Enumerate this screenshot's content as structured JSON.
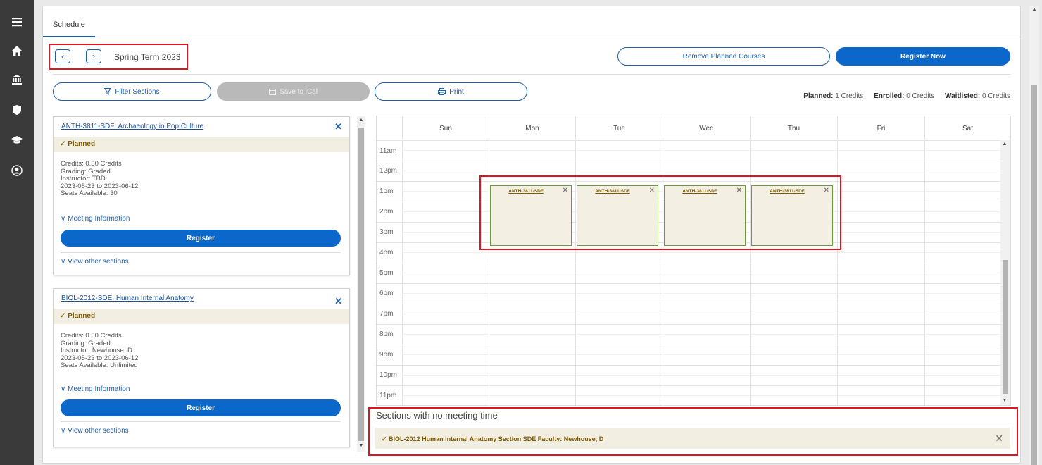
{
  "nav": {
    "icons": [
      "menu-icon",
      "home-icon",
      "bank-icon",
      "shield-icon",
      "graduation-cap-icon",
      "user-circle-icon"
    ]
  },
  "tab": {
    "label": "Schedule"
  },
  "term": {
    "prev": "‹",
    "next": "›",
    "label": "Spring Term 2023"
  },
  "actions": {
    "remove_planned": "Remove Planned Courses",
    "register_now": "Register Now",
    "filter_sections": "Filter Sections",
    "save_ical": "Save to iCal",
    "print": "Print"
  },
  "credits": {
    "planned_label": "Planned:",
    "planned_value": "1 Credits",
    "enrolled_label": "Enrolled:",
    "enrolled_value": "0 Credits",
    "waitlisted_label": "Waitlisted:",
    "waitlisted_value": "0 Credits"
  },
  "courses": [
    {
      "title": "ANTH-3811-SDF: Archaeology in Pop Culture",
      "status": "Planned",
      "credits": "Credits: 0.50 Credits",
      "grading": "Grading: Graded",
      "instructor": "Instructor: TBD",
      "dates": "2023-05-23 to 2023-06-12",
      "seats": "Seats Available:  30",
      "meeting_info": "Meeting Information",
      "register": "Register",
      "other_sections": "View other sections"
    },
    {
      "title": "BIOL-2012-SDE: Human Internal Anatomy",
      "status": "Planned",
      "credits": "Credits: 0.50 Credits",
      "grading": "Grading: Graded",
      "instructor": "Instructor: Newhouse, D",
      "dates": "2023-05-23 to 2023-06-12",
      "seats": "Seats Available:  Unlimited",
      "meeting_info": "Meeting Information",
      "register": "Register",
      "other_sections": "View other sections"
    }
  ],
  "calendar": {
    "days": [
      "Sun",
      "Mon",
      "Tue",
      "Wed",
      "Thu",
      "Fri",
      "Sat"
    ],
    "hours": [
      "11am",
      "12pm",
      "1pm",
      "2pm",
      "3pm",
      "4pm",
      "5pm",
      "6pm",
      "7pm",
      "8pm",
      "9pm",
      "10pm",
      "11pm"
    ],
    "events": [
      {
        "label": "ANTH-3811-SDF",
        "day": "Mon",
        "start": "1pm",
        "end": "4pm"
      },
      {
        "label": "ANTH-3811-SDF",
        "day": "Tue",
        "start": "1pm",
        "end": "4pm"
      },
      {
        "label": "ANTH-3811-SDF",
        "day": "Wed",
        "start": "1pm",
        "end": "4pm"
      },
      {
        "label": "ANTH-3811-SDF",
        "day": "Thu",
        "start": "1pm",
        "end": "4pm"
      }
    ]
  },
  "no_meeting": {
    "title": "Sections with no meeting time",
    "item": "BIOL-2012 Human Internal Anatomy Section SDE Faculty: Newhouse, D"
  },
  "colors": {
    "primary": "#0b67c9",
    "highlight": "#e0141e",
    "planned_bg": "#f2eee1",
    "planned_text": "#7a5a00"
  }
}
